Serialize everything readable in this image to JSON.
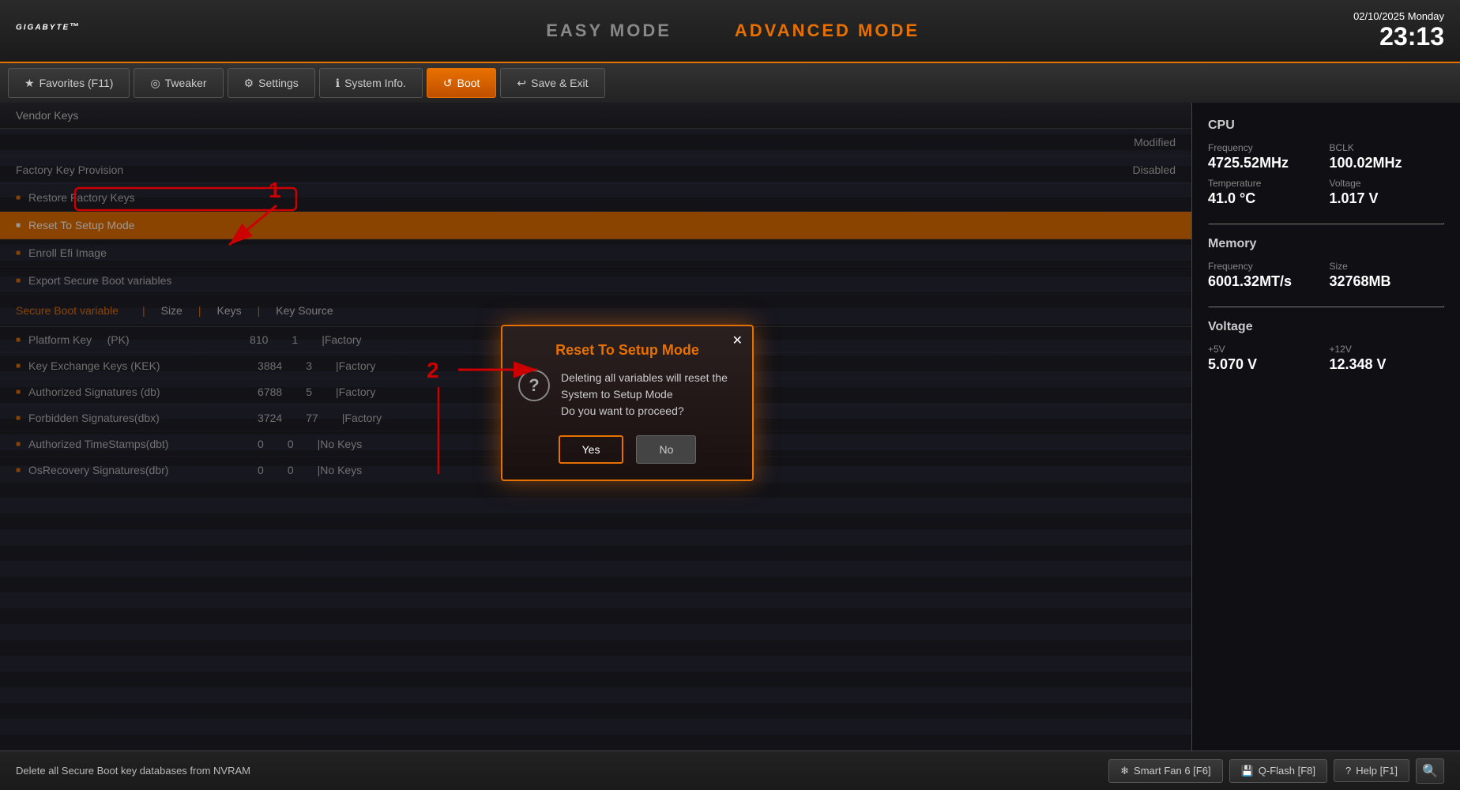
{
  "header": {
    "logo": "GIGABYTE",
    "logo_tm": "™",
    "easy_mode_label": "EASY MODE",
    "advanced_mode_label": "ADVANCED MODE",
    "date": "02/10/2025  Monday",
    "time": "23:13"
  },
  "nav": {
    "tabs": [
      {
        "id": "favorites",
        "icon": "★",
        "label": "Favorites (F11)",
        "active": false
      },
      {
        "id": "tweaker",
        "icon": "◎",
        "label": "Tweaker",
        "active": false
      },
      {
        "id": "settings",
        "icon": "⚙",
        "label": "Settings",
        "active": false
      },
      {
        "id": "sysinfo",
        "icon": "ℹ",
        "label": "System Info.",
        "active": false
      },
      {
        "id": "boot",
        "icon": "↺",
        "label": "Boot",
        "active": true
      },
      {
        "id": "saveexit",
        "icon": "↩",
        "label": "Save & Exit",
        "active": false
      }
    ]
  },
  "left_panel": {
    "vendor_keys": {
      "section_title": "Vendor Keys",
      "modified_label": "Modified",
      "factory_key_label": "Factory Key Provision",
      "disabled_label": "Disabled",
      "menu_items": [
        {
          "label": "Restore Factory Keys",
          "highlighted": false
        },
        {
          "label": "Reset To Setup Mode",
          "highlighted": true
        },
        {
          "label": "Enroll Efi Image",
          "highlighted": false
        },
        {
          "label": "Export Secure Boot variables",
          "highlighted": false
        }
      ]
    },
    "secure_boot": {
      "header_label": "Secure Boot variable",
      "col_size": "Size",
      "col_keys": "Keys",
      "col_source": "Key Source",
      "rows": [
        {
          "name": "Platform Key",
          "abbr": "(PK)",
          "size": "810",
          "keys": "1",
          "source": "Factory"
        },
        {
          "name": "Key Exchange Keys",
          "abbr": "(KEK)",
          "size": "3884",
          "keys": "3",
          "source": "Factory"
        },
        {
          "name": "Authorized Signatures",
          "abbr": "(db)",
          "size": "6788",
          "keys": "5",
          "source": "Factory"
        },
        {
          "name": "Forbidden  Signatures(dbx)",
          "abbr": "",
          "size": "3724",
          "keys": "77",
          "source": "Factory"
        },
        {
          "name": "Authorized TimeStamps(dbt)",
          "abbr": "",
          "size": "0",
          "keys": "0",
          "source": "No Keys"
        },
        {
          "name": "OsRecovery Signatures(dbr)",
          "abbr": "",
          "size": "0",
          "keys": "0",
          "source": "No Keys"
        }
      ]
    }
  },
  "right_panel": {
    "cpu_section": {
      "title": "CPU",
      "frequency_label": "Frequency",
      "frequency_value": "4725.52MHz",
      "bclk_label": "BCLK",
      "bclk_value": "100.02MHz",
      "temp_label": "Temperature",
      "temp_value": "41.0 °C",
      "voltage_label": "Voltage",
      "voltage_value": "1.017 V"
    },
    "memory_section": {
      "title": "Memory",
      "freq_label": "Frequency",
      "freq_value": "6001.32MT/s",
      "size_label": "Size",
      "size_value": "32768MB"
    },
    "voltage_section": {
      "title": "Voltage",
      "v5_label": "+5V",
      "v5_value": "5.070 V",
      "v12_label": "+12V",
      "v12_value": "12.348 V"
    }
  },
  "dialog": {
    "title": "Reset To Setup Mode",
    "message": "Deleting all variables will reset the System to Setup Mode\nDo you want to proceed?",
    "yes_label": "Yes",
    "no_label": "No"
  },
  "footer": {
    "delete_label": "Delete all Secure Boot key databases from NVRAM",
    "smart_fan_label": "Smart Fan 6 [F6]",
    "qflash_label": "Q-Flash [F8]",
    "help_label": "Help [F1]"
  }
}
